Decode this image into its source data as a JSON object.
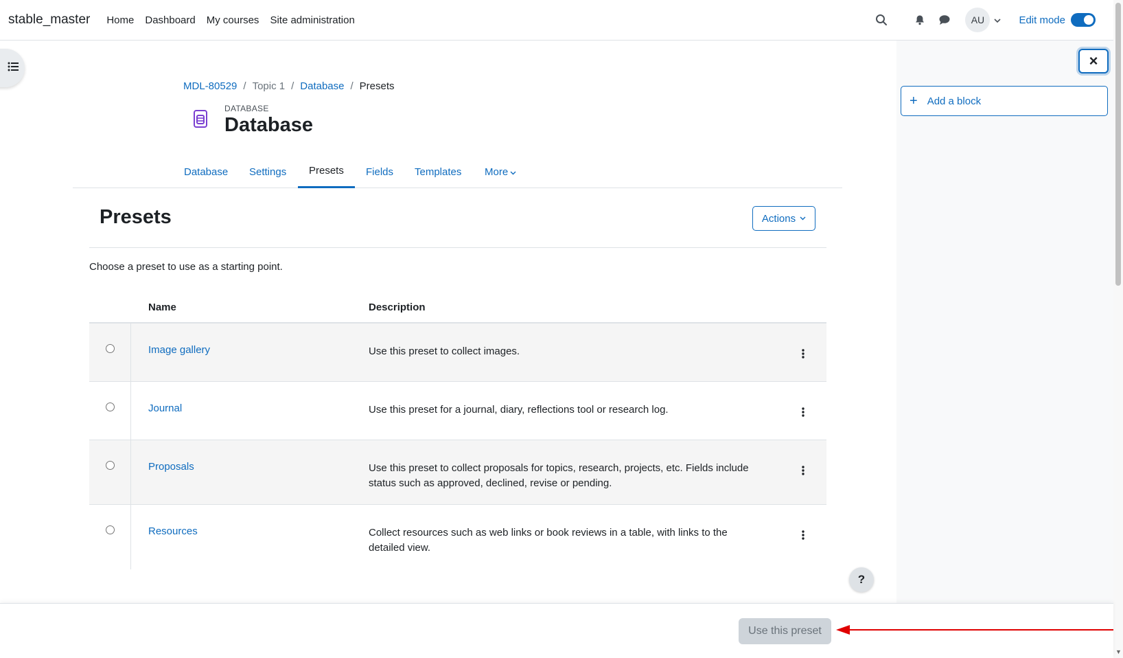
{
  "navbar": {
    "brand": "stable_master",
    "items": [
      "Home",
      "Dashboard",
      "My courses",
      "Site administration"
    ],
    "avatar_initials": "AU",
    "edit_mode_label": "Edit mode",
    "edit_mode_on": true
  },
  "icons": {
    "search": "search-icon",
    "notifications": "bell-icon",
    "messages": "chat-icon",
    "drawer_toggle": "list-icon",
    "close": "close-icon",
    "kebab": "kebab-icon"
  },
  "block_drawer": {
    "add_block_label": "Add a block",
    "close_symbol": "×"
  },
  "breadcrumb": {
    "course": "MDL-80529",
    "section": "Topic 1",
    "activity": "Database",
    "current": "Presets",
    "separator": "/"
  },
  "header": {
    "activity_type": "DATABASE",
    "title": "Database"
  },
  "tabs": [
    {
      "label": "Database",
      "active": false
    },
    {
      "label": "Settings",
      "active": false
    },
    {
      "label": "Presets",
      "active": true
    },
    {
      "label": "Fields",
      "active": false
    },
    {
      "label": "Templates",
      "active": false
    },
    {
      "label": "More",
      "active": false
    }
  ],
  "main": {
    "section_title": "Presets",
    "actions_label": "Actions",
    "intro": "Choose a preset to use as a starting point."
  },
  "table": {
    "columns": [
      "Name",
      "Description"
    ],
    "rows": [
      {
        "name": "Image gallery",
        "description": "Use this preset to collect images."
      },
      {
        "name": "Journal",
        "description": "Use this preset for a journal, diary, reflections tool or research log."
      },
      {
        "name": "Proposals",
        "description": "Use this preset to collect proposals for topics, research, projects, etc. Fields include status such as approved, declined, revise or pending."
      },
      {
        "name": "Resources",
        "description": "Collect resources such as web links or book reviews in a table, with links to the detailed view."
      }
    ]
  },
  "help_label": "?",
  "footer": {
    "use_preset_label": "Use this preset",
    "use_preset_disabled": true
  },
  "colors": {
    "primary": "#0f6cbf",
    "annotation_arrow": "#e00000"
  }
}
